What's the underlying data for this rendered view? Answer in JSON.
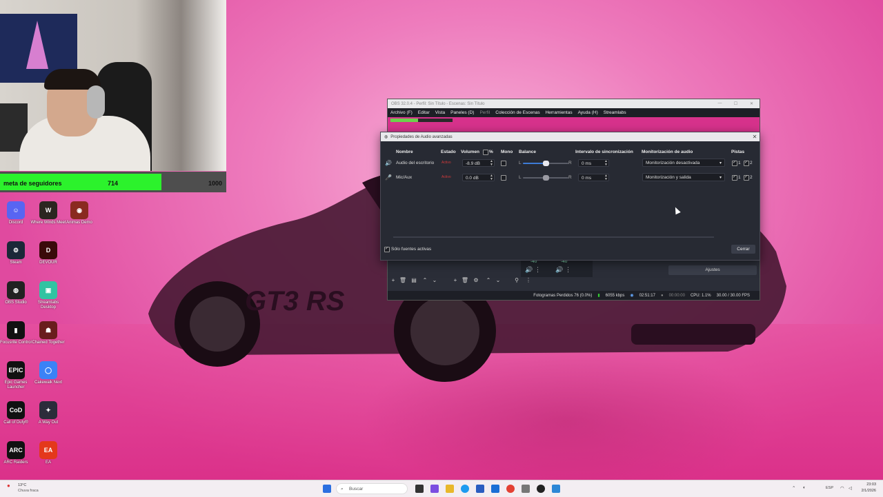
{
  "goal": {
    "label": "meta de seguidores",
    "current": "714",
    "max": "1000",
    "progress": 0.714
  },
  "desktop_icons": [
    {
      "label": "Discord",
      "color": "#5865F2",
      "glyph": "☺"
    },
    {
      "label": "Where Winds Meet",
      "color": "#2b2620",
      "glyph": "W"
    },
    {
      "label": "Animas Demo",
      "color": "#8a2a20",
      "glyph": "◉"
    },
    {
      "label": "Steam",
      "color": "#1b2838",
      "glyph": "⚙"
    },
    {
      "label": "DEVOUR",
      "color": "#3a0a0a",
      "glyph": "D"
    },
    {
      "label": "OBS Studio",
      "color": "#222222",
      "glyph": "◍"
    },
    {
      "label": "Streamlabs Desktop",
      "color": "#31c3a2",
      "glyph": "▣"
    },
    {
      "label": "Focusrite Control",
      "color": "#111111",
      "glyph": "▮"
    },
    {
      "label": "Chained Together",
      "color": "#6a1d1d",
      "glyph": "☗"
    },
    {
      "label": "Epic Games Launcher",
      "color": "#111111",
      "glyph": "EPIC"
    },
    {
      "label": "Cakewalk Next",
      "color": "#3b82f6",
      "glyph": "◯"
    },
    {
      "label": "Call of Duty®",
      "color": "#111111",
      "glyph": "CoD"
    },
    {
      "label": "A Way Out",
      "color": "#2c2c3a",
      "glyph": "✦"
    },
    {
      "label": "ARC Raiders",
      "color": "#111111",
      "glyph": "ARC"
    },
    {
      "label": "EA",
      "color": "#e4381b",
      "glyph": "EA"
    }
  ],
  "obs": {
    "title": "OBS 32.0.4 - Perfil: Sin Título - Escenas: Sin Título",
    "menu": [
      "Archivo (F)",
      "Editar",
      "Vista",
      "Paneles (D)",
      "Perfil",
      "Colección de Escenas",
      "Herramientas",
      "Ayuda (H)",
      "Streamlabs"
    ],
    "ajustes": "Ajustes",
    "meter_labels": [
      "-40",
      "-40"
    ],
    "status": {
      "dropped": "Fotogramas Perdidos 76 (0.0%)",
      "bitrate": "6055 kbps",
      "stream_time": "02:51:17",
      "rec_time": "00:00:00",
      "cpu": "CPU: 1.1%",
      "fps": "30.00 / 30.00 FPS"
    }
  },
  "dialog": {
    "title": "Propiedades de Audio avanzadas",
    "headers": {
      "name": "Nombre",
      "status": "Estado",
      "volume": "Volumen",
      "percent": "%",
      "mono": "Mono",
      "balance": "Balance",
      "sync": "Intervalo de sincronización",
      "monitor": "Monitorización de audio",
      "tracks": "Pistas"
    },
    "rows": [
      {
        "name": "Audio del escritorio",
        "status": "Activo",
        "volume": "-8.9 dB",
        "mono": false,
        "balance_left": "L",
        "balance_right": "R",
        "balance_level": 0.5,
        "volume_level": 0.82,
        "sync": "0 ms",
        "monitor": "Monitorización desactivada",
        "track1": "1",
        "track2": "2"
      },
      {
        "name": "Mic/Aux",
        "status": "Activo",
        "volume": "0.0 dB",
        "mono": false,
        "balance_left": "L",
        "balance_right": "R",
        "balance_level": 0.5,
        "volume_level": 1.0,
        "sync": "0 ms",
        "monitor": "Monitorización y salida",
        "track1": "1",
        "track2": "2"
      }
    ],
    "only_active_label": "Sólo fuentes activas",
    "close_label": "Cerrar"
  },
  "taskbar": {
    "weather_temp": "13°C",
    "weather_desc": "Chuva fraca",
    "search_placeholder": "Buscar",
    "lang": "ESP",
    "time": "23:03",
    "date": "2/1/2026"
  },
  "colors": {
    "accent": "#3d7bd6",
    "status_active": "#d23a3a",
    "goal_fill": "#2cf22c"
  }
}
